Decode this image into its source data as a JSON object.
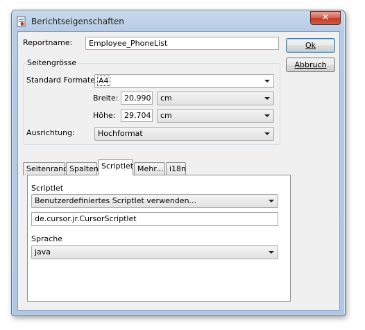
{
  "window": {
    "title": "Berichtseigenschaften",
    "close_symbol": "✕"
  },
  "report": {
    "label": "Reportname:",
    "value": "Employee_PhoneList"
  },
  "buttons": {
    "ok": "Ok",
    "cancel": "Abbruch"
  },
  "page_size": {
    "group_label": "Seitengrösse",
    "format_label": "Standard Formate:",
    "format_value": "A4",
    "width_label": "Breite:",
    "width_value": "20,990",
    "width_unit": "cm",
    "height_label": "Höhe:",
    "height_value": "29,704",
    "height_unit": "cm",
    "orientation_label": "Ausrichtung:",
    "orientation_value": "Hochformat"
  },
  "tabs": [
    {
      "label": "Seitenrand"
    },
    {
      "label": "Spalten"
    },
    {
      "label": "Scriptlet"
    },
    {
      "label": "Mehr..."
    },
    {
      "label": "i18n"
    }
  ],
  "scriptlet": {
    "section_label": "Scriptlet",
    "mode_value": "Benutzerdefiniertes Scriptlet verwenden...",
    "class_value": "de.cursor.jr.CursorScriptlet",
    "language_label": "Sprache",
    "language_value": "java"
  }
}
